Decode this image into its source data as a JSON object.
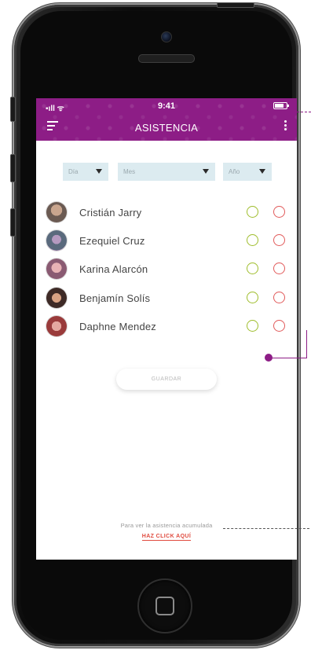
{
  "status_bar": {
    "time": "9:41",
    "signal": "▪ıll ᯤ"
  },
  "header": {
    "title": "ASISTENCIA"
  },
  "filters": [
    {
      "label": "Día"
    },
    {
      "label": "Mes"
    },
    {
      "label": "Año"
    }
  ],
  "students": [
    {
      "name": "Cristián Jarry"
    },
    {
      "name": "Ezequiel Cruz"
    },
    {
      "name": "Karina Alarcón"
    },
    {
      "name": "Benjamín Solís"
    },
    {
      "name": "Daphne Mendez"
    }
  ],
  "save_button": {
    "label": "GUARDAR"
  },
  "footer": {
    "hint": "Para ver la asistencia acumulada",
    "link": "HAZ CLICK AQUÍ"
  },
  "colors": {
    "brand": "#8d1d86",
    "present": "#9fbd2c",
    "absent": "#e15a5a",
    "filter_bg": "#dcebf0",
    "link": "#e04b3f"
  }
}
